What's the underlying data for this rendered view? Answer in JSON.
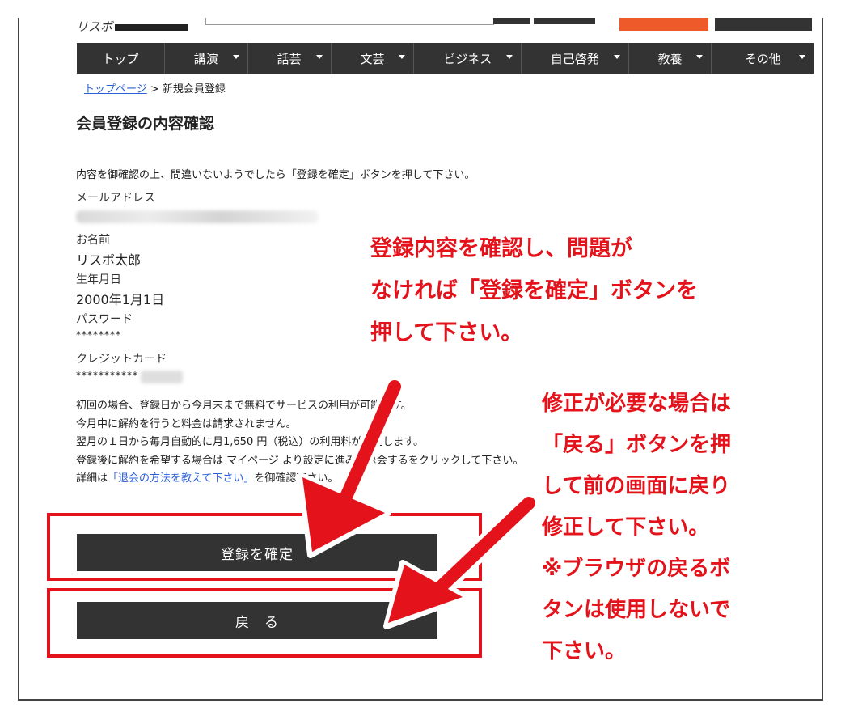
{
  "header": {
    "logo": "リスボ"
  },
  "nav": {
    "items": [
      {
        "label": "トップ",
        "caret": false,
        "width": 110
      },
      {
        "label": "講演",
        "caret": true,
        "width": 104
      },
      {
        "label": "話芸",
        "caret": true,
        "width": 104
      },
      {
        "label": "文芸",
        "caret": true,
        "width": 104
      },
      {
        "label": "ビジネス",
        "caret": true,
        "width": 134
      },
      {
        "label": "自己啓発",
        "caret": true,
        "width": 134
      },
      {
        "label": "教養",
        "caret": true,
        "width": 104
      },
      {
        "label": "その他",
        "caret": true,
        "width": 127
      }
    ]
  },
  "breadcrumb": {
    "home": "トップページ",
    "separator": " > ",
    "current": "新規会員登録"
  },
  "page": {
    "title": "会員登録の内容確認",
    "intro": "内容を御確認の上、間違いないようでしたら「登録を確定」ボタンを押して下さい。"
  },
  "fields": {
    "email_label": "メールアドレス",
    "name_label": "お名前",
    "name_value": "リスボ太郎",
    "birthday_label": "生年月日",
    "birthday_value": "2000年1月1日",
    "password_label": "パスワード",
    "password_value": "********",
    "card_label": "クレジットカード",
    "card_value": "***********"
  },
  "notes": {
    "line1": "初回の場合、登録日から今月末まで無料でサービスの利用が可能です。",
    "line2": "今月中に解約を行うと料金は請求されません。",
    "line3": "翌月の１日から毎月自動的に月1,650 円（税込）の利用料が発生します。",
    "line4": "登録後に解約を希望する場合は マイページ より設定に進み、退会するをクリックして下さい。",
    "line5_prefix": "詳細は",
    "line5_link": "「退会の方法を教えて下さい」",
    "line5_suffix": "を御確認下さい。"
  },
  "buttons": {
    "confirm": "登録を確定",
    "back": "戻　る"
  },
  "annotations": {
    "top_line1": "登録内容を確認し、問題が",
    "top_line2": "なければ「登録を確定」ボタンを",
    "top_line3": "押して下さい。",
    "right_line1": "修正が必要な場合は",
    "right_line2": "「戻る」ボタンを押",
    "right_line3": "して前の画面に戻り",
    "right_line4": "修正して下さい。",
    "right_line5": "※ブラウザの戻るボ",
    "right_line6": "タンは使用しないで",
    "right_line7": "下さい。"
  },
  "colors": {
    "accent_red": "#e4131b",
    "nav_bg": "#333333",
    "link_blue": "#2a5fd6",
    "header_orange": "#ee5a2a"
  }
}
